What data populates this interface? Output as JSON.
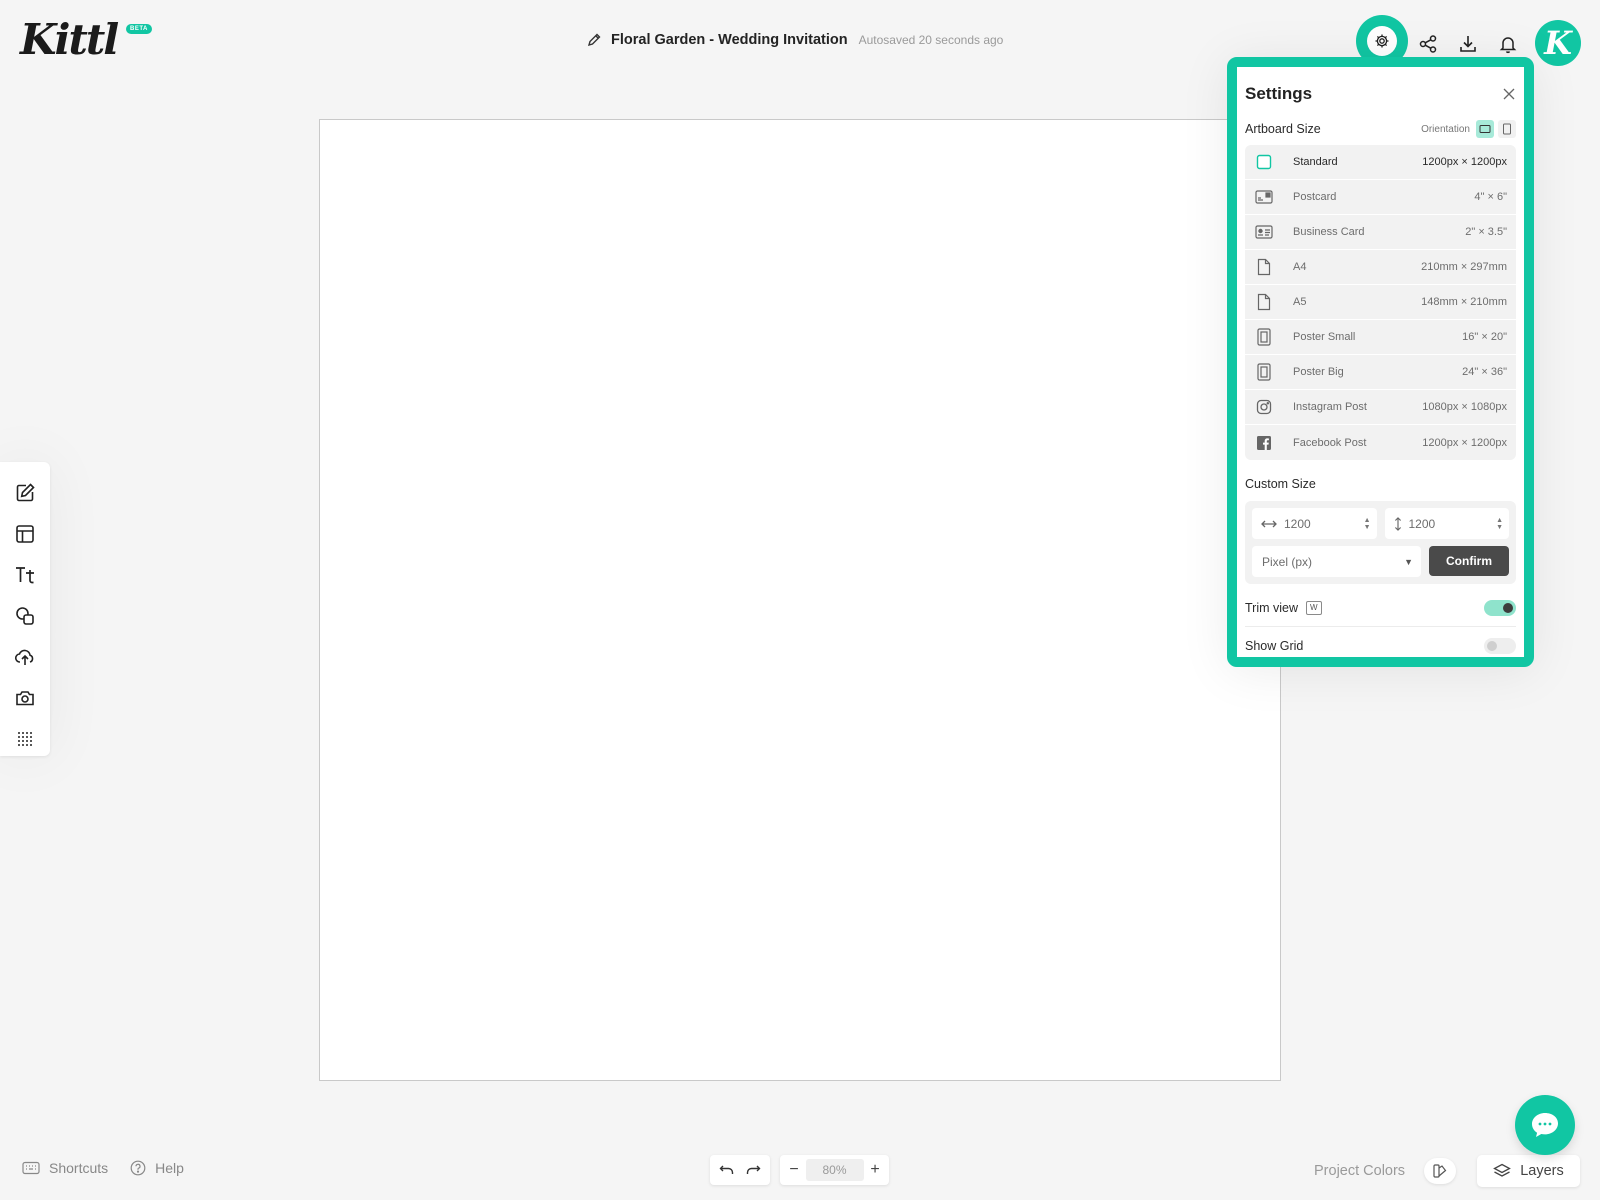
{
  "app": {
    "logo": "Kittl",
    "badge": "BETA"
  },
  "header": {
    "doc_title": "Floral Garden - Wedding Invitation",
    "autosave": "Autosaved 20 seconds ago",
    "avatar_letter": "K",
    "icons": [
      "gear-icon",
      "share-icon",
      "download-icon",
      "bell-icon"
    ]
  },
  "toolbar": {
    "tools": [
      "edit-icon",
      "templates-icon",
      "text-icon",
      "shapes-icon",
      "upload-icon",
      "camera-icon",
      "grid-dots-icon"
    ]
  },
  "settings": {
    "title": "Settings",
    "artboard_size_label": "Artboard Size",
    "orientation_label": "Orientation",
    "orientation_selected": "landscape",
    "sizes": [
      {
        "name": "Standard",
        "dims": "1200px × 1200px",
        "icon": "square-icon",
        "selected": true
      },
      {
        "name": "Postcard",
        "dims": "4\" × 6\"",
        "icon": "postcard-icon"
      },
      {
        "name": "Business Card",
        "dims": "2\" × 3.5\"",
        "icon": "business-card-icon"
      },
      {
        "name": "A4",
        "dims": "210mm × 297mm",
        "icon": "page-icon"
      },
      {
        "name": "A5",
        "dims": "148mm × 210mm",
        "icon": "page-icon"
      },
      {
        "name": "Poster Small",
        "dims": "16\" × 20\"",
        "icon": "poster-icon"
      },
      {
        "name": "Poster Big",
        "dims": "24\" × 36\"",
        "icon": "poster-icon"
      },
      {
        "name": "Instagram Post",
        "dims": "1080px × 1080px",
        "icon": "instagram-icon"
      },
      {
        "name": "Facebook Post",
        "dims": "1200px × 1200px",
        "icon": "facebook-icon"
      }
    ],
    "custom_size_label": "Custom Size",
    "width_value": "1200",
    "height_value": "1200",
    "unit": "Pixel (px)",
    "confirm_label": "Confirm",
    "trim_view_label": "Trim view",
    "trim_view_shortcut": "W",
    "trim_view_on": true,
    "show_grid_label": "Show Grid",
    "show_grid_on": false
  },
  "bottom": {
    "shortcuts": "Shortcuts",
    "help": "Help",
    "zoom": "80%",
    "zoom_minus": "−",
    "zoom_plus": "+",
    "project_colors": "Project Colors",
    "layers": "Layers"
  },
  "colors": {
    "accent": "#11c6a3",
    "dark_button": "#4a4a4a",
    "background": "#f5f5f5"
  }
}
